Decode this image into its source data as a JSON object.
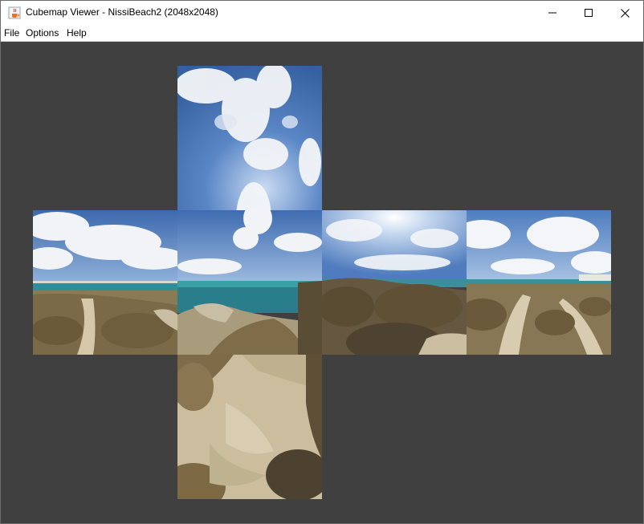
{
  "window": {
    "title": "Cubemap Viewer - NissiBeach2 (2048x2048)",
    "app_icon": "java-cup-icon",
    "controls": [
      "minimize-icon",
      "maximize-icon",
      "close-icon"
    ]
  },
  "menu": {
    "items": [
      {
        "label": "File"
      },
      {
        "label": "Options"
      },
      {
        "label": "Help"
      }
    ]
  },
  "viewer": {
    "background_color": "#404040",
    "faces": [
      "top",
      "left",
      "front",
      "right",
      "back",
      "bottom"
    ],
    "colors": {
      "sky": "#3f6db6",
      "sky_light": "#a9c3e6",
      "cloud": "#f2f4f7",
      "sea": "#2e8a96",
      "land": "#8a7a58",
      "shrub": "#6b5a3a",
      "sand": "#cdbfa0"
    }
  }
}
